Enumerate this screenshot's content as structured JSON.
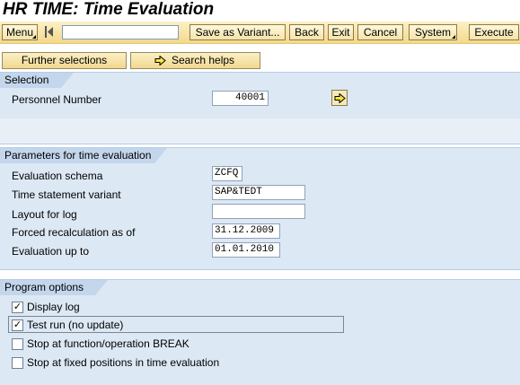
{
  "title": "HR TIME: Time Evaluation",
  "toolbar": {
    "menu_label": "Menu",
    "save_variant_label": "Save as Variant...",
    "back_label": "Back",
    "exit_label": "Exit",
    "cancel_label": "Cancel",
    "system_label": "System",
    "execute_label": "Execute",
    "command_field_value": ""
  },
  "buttons": {
    "further_selections": "Further selections",
    "search_helps": "Search helps"
  },
  "selection": {
    "header": "Selection",
    "personnel_number_label": "Personnel Number",
    "personnel_number_value": "40001"
  },
  "parameters": {
    "header": "Parameters for time evaluation",
    "fields": [
      {
        "label": "Evaluation schema",
        "value": "ZCFQ"
      },
      {
        "label": "Time statement variant",
        "value": "SAP&TEDT"
      },
      {
        "label": "Layout for log",
        "value": ""
      },
      {
        "label": "Forced recalculation as of",
        "value": "31.12.2009"
      },
      {
        "label": "Evaluation up to",
        "value": "01.01.2010"
      }
    ]
  },
  "program_options": {
    "header": "Program options",
    "options": [
      {
        "label": "Display log",
        "checked": true,
        "mark": "✓"
      },
      {
        "label": "Test run (no update)",
        "checked": true,
        "mark": "✓"
      },
      {
        "label": "Stop at function/operation BREAK",
        "checked": false,
        "mark": ""
      },
      {
        "label": "Stop at fixed positions in time evaluation",
        "checked": false,
        "mark": ""
      }
    ]
  },
  "colors": {
    "toolbar_bg": "#f3d98c",
    "group_bg": "#dce8f4",
    "group_header_bg": "#c4d6ec",
    "button_bg": "#f1d88f"
  }
}
